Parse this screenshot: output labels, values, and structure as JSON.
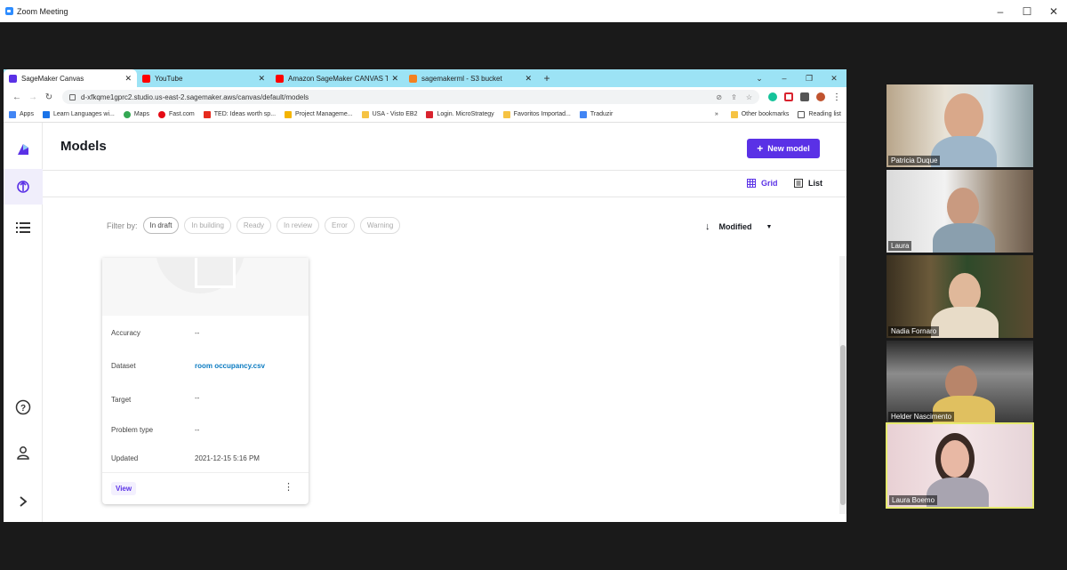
{
  "zoom": {
    "title": "Zoom Meeting",
    "controls": [
      "–",
      "☐",
      "✕"
    ]
  },
  "browser": {
    "tabs": [
      {
        "title": "SageMaker Canvas",
        "close": "✕",
        "color": "#5a31e6"
      },
      {
        "title": "YouTube",
        "close": "✕",
        "color": "#ff0000"
      },
      {
        "title": "Amazon SageMaker CANVAS Tu",
        "close": "✕",
        "color": "#ff0000"
      },
      {
        "title": "sagemakerml - S3 bucket",
        "close": "✕",
        "color": "#f4811f"
      }
    ],
    "new_tab": "+",
    "window_controls": [
      "⌄",
      "–",
      "❐",
      "✕"
    ],
    "url": "d-xfkqme1gprc2.studio.us-east-2.sagemaker.aws/canvas/default/models",
    "bookmarks": [
      {
        "label": "Apps",
        "color": "#4285f4"
      },
      {
        "label": "Learn Languages wi...",
        "color": "#1a73e8"
      },
      {
        "label": "Maps",
        "color": "#34a853"
      },
      {
        "label": "Fast.com",
        "color": "#e50914"
      },
      {
        "label": "TED: Ideas worth sp...",
        "color": "#e62b1e"
      },
      {
        "label": "Project Manageme...",
        "color": "#f4b400"
      },
      {
        "label": "USA - Visto EB2",
        "color": "#f6c343"
      },
      {
        "label": "Login. MicroStrategy",
        "color": "#d9232e"
      },
      {
        "label": "Favoritos Importad...",
        "color": "#f6c343"
      },
      {
        "label": "Traduzir",
        "color": "#4285f4"
      }
    ],
    "bookmarks_more": "»",
    "other_bookmarks": "Other bookmarks",
    "reading_list": "Reading list"
  },
  "app": {
    "page_title": "Models",
    "new_model_button": "New model",
    "view_grid": "Grid",
    "view_list": "List",
    "filter_label": "Filter by:",
    "filters": [
      "In draft",
      "In building",
      "Ready",
      "In review",
      "Error",
      "Warning"
    ],
    "sort_label": "Modified",
    "card": {
      "fields": [
        {
          "label": "Accuracy",
          "value": "--"
        },
        {
          "label": "Dataset",
          "value": "room occupancy.csv"
        },
        {
          "label": "Target",
          "value": "--"
        },
        {
          "label": "Problem type",
          "value": "--"
        },
        {
          "label": "Updated",
          "value": "2021-12-15 5:16 PM"
        }
      ],
      "view_button": "View",
      "more": "⋮"
    }
  },
  "participants": [
    {
      "name": "Patricia Duque"
    },
    {
      "name": "Laura"
    },
    {
      "name": "Nadia Fornaro"
    },
    {
      "name": "Helder Nascimento"
    },
    {
      "name": "Laura Boemo"
    }
  ]
}
